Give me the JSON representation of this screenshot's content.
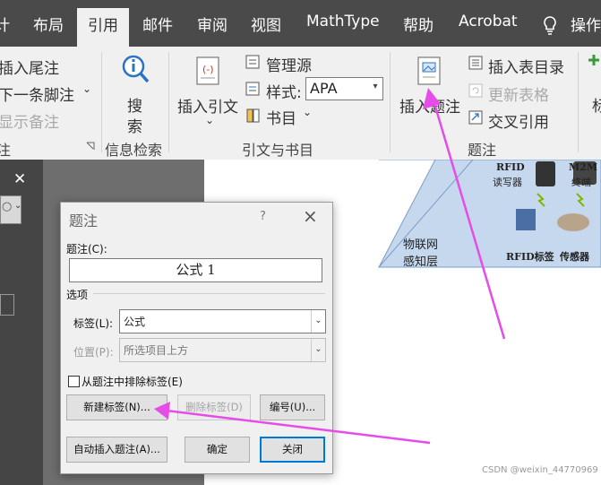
{
  "tabs": [
    {
      "label": "计"
    },
    {
      "label": "布局"
    },
    {
      "label": "引用",
      "active": true
    },
    {
      "label": "邮件"
    },
    {
      "label": "审阅"
    },
    {
      "label": "视图"
    },
    {
      "label": "MathType"
    },
    {
      "label": "帮助"
    },
    {
      "label": "Acrobat"
    },
    {
      "label": "操作"
    }
  ],
  "ribbon": {
    "footnotes": {
      "insert_endnote": "插入尾注",
      "next_footnote": "下一条脚注",
      "show_notes": "显示备注",
      "group_label": "注"
    },
    "research": {
      "search_line1": "搜",
      "search_line2": "索",
      "group_label": "信息检索"
    },
    "citations": {
      "insert_citation": "插入引文",
      "manage_sources": "管理源",
      "style_label": "样式:",
      "style_value": "APA",
      "bibliography": "书目",
      "group_label": "引文与书目"
    },
    "captions": {
      "insert_caption": "插入题注",
      "insert_table_of_figures": "插入表目录",
      "update_table": "更新表格",
      "cross_reference": "交叉引用",
      "group_label": "题注"
    },
    "partial_right": "标"
  },
  "document": {
    "diagram_labels": {
      "rfid_reader_1": "RFID",
      "rfid_reader_2": "读写器",
      "m2m_1": "M2M",
      "m2m_2": "终端",
      "iot_1": "物联网",
      "iot_2": "感知层",
      "rfid_tag": "RFID标签",
      "sensor": "传感器"
    }
  },
  "dialog": {
    "title": "题注",
    "help": "?",
    "caption_label": "题注(C):",
    "caption_value": "公式 1",
    "options_label": "选项",
    "label_label": "标签(L):",
    "label_value": "公式",
    "position_label": "位置(P):",
    "position_value": "所选项目上方",
    "exclude_label": "从题注中排除标签(E)",
    "new_label_button": "新建标签(N)...",
    "delete_label_button": "删除标签(D)",
    "numbering_button": "编号(U)...",
    "autocaption_button": "自动插入题注(A)...",
    "ok_button": "确定",
    "close_button": "关闭"
  },
  "watermark": "CSDN @weixin_44770969",
  "colors": {
    "tab_bar": "#4a4a4a",
    "ribbon": "#f0f0f0",
    "accent_arrow": "#e64ce8",
    "primary_border": "#0078d7"
  }
}
